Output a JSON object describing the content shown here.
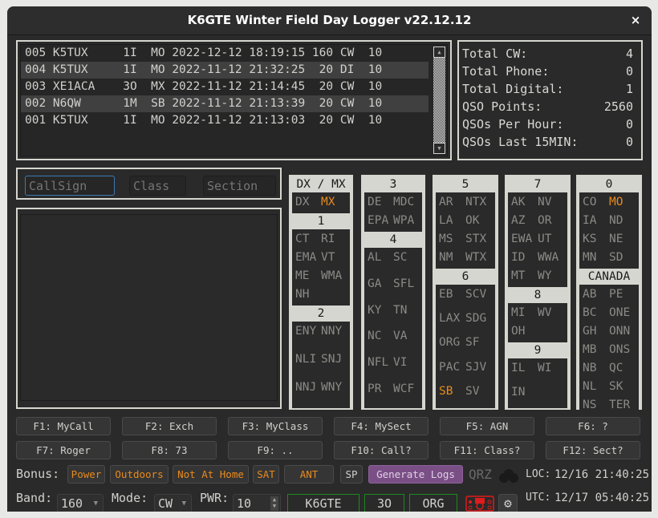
{
  "window": {
    "title": "K6GTE Winter Field Day Logger v22.12.12",
    "close_label": "×"
  },
  "log": {
    "rows": [
      {
        "num": "005",
        "call": "K5TUX",
        "class": "1I",
        "section": "MO",
        "date": "2022-12-12",
        "time": "18:19:15",
        "band": "160",
        "mode": "CW",
        "power": "10"
      },
      {
        "num": "004",
        "call": "K5TUX",
        "class": "1I",
        "section": "MO",
        "date": "2022-11-12",
        "time": "21:32:25",
        "band": "20",
        "mode": "DI",
        "power": "10"
      },
      {
        "num": "003",
        "call": "XE1ACA",
        "class": "3O",
        "section": "MX",
        "date": "2022-11-12",
        "time": "21:14:45",
        "band": "20",
        "mode": "CW",
        "power": "10"
      },
      {
        "num": "002",
        "call": "N6QW",
        "class": "1M",
        "section": "SB",
        "date": "2022-11-12",
        "time": "21:13:39",
        "band": "20",
        "mode": "CW",
        "power": "10"
      },
      {
        "num": "001",
        "call": "K5TUX",
        "class": "1I",
        "section": "MO",
        "date": "2022-11-12",
        "time": "21:13:03",
        "band": "20",
        "mode": "CW",
        "power": "10"
      }
    ]
  },
  "stats": [
    {
      "label": "Total CW:",
      "value": "4"
    },
    {
      "label": "Total Phone:",
      "value": "0"
    },
    {
      "label": "Total Digital:",
      "value": "1"
    },
    {
      "label": "QSO Points:",
      "value": "2560"
    },
    {
      "label": "QSOs Per Hour:",
      "value": "0"
    },
    {
      "label": "QSOs Last 15MIN:",
      "value": "0"
    }
  ],
  "entry": {
    "callsign": {
      "value": "",
      "placeholder": "CallSign"
    },
    "class": {
      "value": "",
      "placeholder": "Class"
    },
    "section": {
      "value": "",
      "placeholder": "Section"
    }
  },
  "sections": [
    {
      "groups": [
        {
          "title": "DX / MX",
          "items": [
            {
              "t": "DX"
            },
            {
              "t": "MX",
              "hl": true
            }
          ]
        },
        {
          "title": "1",
          "items": [
            {
              "t": "CT"
            },
            {
              "t": "RI"
            },
            {
              "t": "EMA"
            },
            {
              "t": "VT"
            },
            {
              "t": "ME"
            },
            {
              "t": "WMA"
            },
            {
              "t": "NH"
            }
          ]
        },
        {
          "title": "2",
          "items": [
            {
              "t": "ENY"
            },
            {
              "t": "NNY"
            },
            {
              "t": "NLI"
            },
            {
              "t": "SNJ"
            },
            {
              "t": "NNJ"
            },
            {
              "t": "WNY"
            }
          ]
        }
      ]
    },
    {
      "groups": [
        {
          "title": "3",
          "items": [
            {
              "t": "DE"
            },
            {
              "t": "MDC"
            },
            {
              "t": "EPA"
            },
            {
              "t": "WPA"
            }
          ]
        },
        {
          "title": "4",
          "items": [
            {
              "t": "AL"
            },
            {
              "t": "SC"
            },
            {
              "t": "GA"
            },
            {
              "t": "SFL"
            },
            {
              "t": "KY"
            },
            {
              "t": "TN"
            },
            {
              "t": "NC"
            },
            {
              "t": "VA"
            },
            {
              "t": "NFL"
            },
            {
              "t": "VI"
            },
            {
              "t": "PR"
            },
            {
              "t": "WCF"
            }
          ]
        }
      ]
    },
    {
      "groups": [
        {
          "title": "5",
          "items": [
            {
              "t": "AR"
            },
            {
              "t": "NTX"
            },
            {
              "t": "LA"
            },
            {
              "t": "OK"
            },
            {
              "t": "MS"
            },
            {
              "t": "STX"
            },
            {
              "t": "NM"
            },
            {
              "t": "WTX"
            }
          ]
        },
        {
          "title": "6",
          "items": [
            {
              "t": "EB"
            },
            {
              "t": "SCV"
            },
            {
              "t": "LAX"
            },
            {
              "t": "SDG"
            },
            {
              "t": "ORG"
            },
            {
              "t": "SF"
            },
            {
              "t": "PAC"
            },
            {
              "t": "SJV"
            },
            {
              "t": "SB",
              "hl": true
            },
            {
              "t": "SV"
            }
          ]
        }
      ]
    },
    {
      "groups": [
        {
          "title": "7",
          "items": [
            {
              "t": "AK"
            },
            {
              "t": "NV"
            },
            {
              "t": "AZ"
            },
            {
              "t": "OR"
            },
            {
              "t": "EWA"
            },
            {
              "t": "UT"
            },
            {
              "t": "ID"
            },
            {
              "t": "WWA"
            },
            {
              "t": "MT"
            },
            {
              "t": "WY"
            }
          ]
        },
        {
          "title": "8",
          "items": [
            {
              "t": "MI"
            },
            {
              "t": "WV"
            },
            {
              "t": "OH"
            }
          ]
        },
        {
          "title": "9",
          "items": [
            {
              "t": "IL"
            },
            {
              "t": "WI"
            },
            {
              "t": "IN"
            }
          ]
        }
      ]
    },
    {
      "groups": [
        {
          "title": "0",
          "items": [
            {
              "t": "CO"
            },
            {
              "t": "MO",
              "hl": true
            },
            {
              "t": "IA"
            },
            {
              "t": "ND"
            },
            {
              "t": "KS"
            },
            {
              "t": "NE"
            },
            {
              "t": "MN"
            },
            {
              "t": "SD"
            }
          ]
        },
        {
          "title": "CANADA",
          "items": [
            {
              "t": "AB"
            },
            {
              "t": "PE"
            },
            {
              "t": "BC"
            },
            {
              "t": "ONE"
            },
            {
              "t": "GH"
            },
            {
              "t": "ONN"
            },
            {
              "t": "MB"
            },
            {
              "t": "ONS"
            },
            {
              "t": "NB"
            },
            {
              "t": "QC"
            },
            {
              "t": "NL"
            },
            {
              "t": "SK"
            },
            {
              "t": "NS"
            },
            {
              "t": "TER"
            }
          ]
        }
      ]
    }
  ],
  "function_keys": [
    "F1: MyCall",
    "F2: Exch",
    "F3: MyClass",
    "F4: MySect",
    "F5: AGN",
    "F6: ?",
    "F7: Roger",
    "F8: 73",
    "F9: ..",
    "F10: Call?",
    "F11: Class?",
    "F12: Sect?"
  ],
  "bonus": {
    "label": "Bonus:",
    "buttons": [
      "Power",
      "Outdoors",
      "Not At Home",
      "SAT",
      "ANT"
    ]
  },
  "sp_label": "SP",
  "generate_logs_label": "Generate Logs",
  "qrz_label": "QRZ",
  "band": {
    "label": "Band:",
    "value": "160"
  },
  "mode": {
    "label": "Mode:",
    "value": "CW"
  },
  "power": {
    "label": "PWR:",
    "value": "10"
  },
  "station": {
    "call": "K6GTE",
    "class": "3O",
    "section": "ORG"
  },
  "clock": {
    "loc_label": "LOC:",
    "loc_value": "12/16 21:40:25",
    "utc_label": "UTC:",
    "utc_value": "12/17 05:40:25"
  },
  "colors": {
    "accent": "#e98a1c",
    "generate_logs": "#7a4f86",
    "station_border": "#1d8a1d",
    "radio_icon": "#e01b1b"
  }
}
